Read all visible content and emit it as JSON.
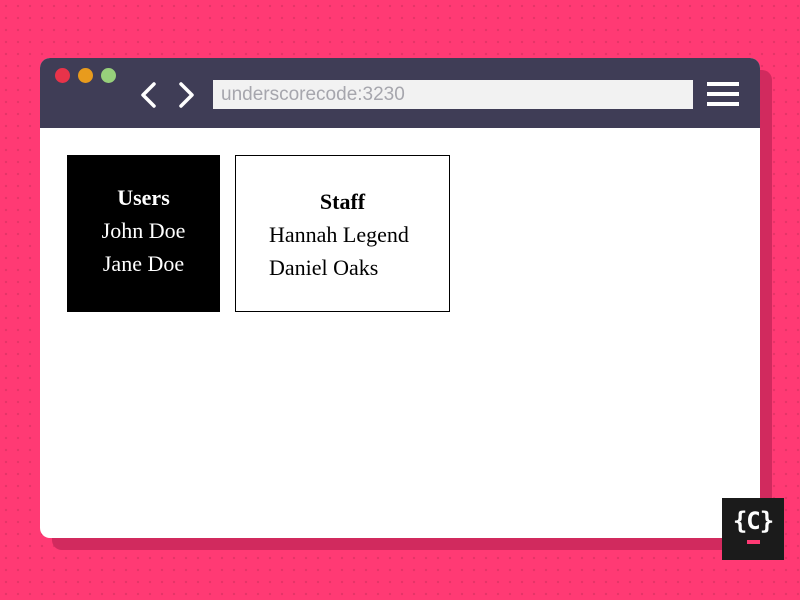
{
  "browser": {
    "address": "underscorecode:3230",
    "window_controls": [
      "close",
      "minimize",
      "maximize"
    ],
    "nav_icons": [
      "chevron-left-icon",
      "chevron-right-icon"
    ],
    "menu_icon": "hamburger-menu-icon"
  },
  "cards": {
    "users": {
      "title": "Users",
      "items": [
        "John Doe",
        "Jane Doe"
      ]
    },
    "staff": {
      "title": "Staff",
      "items": [
        "Hannah Legend",
        "Daniel Oaks"
      ]
    }
  },
  "logo": {
    "text": "{C}"
  },
  "colors": {
    "background": "#ff3a74",
    "titlebar": "#3f3d56",
    "close": "#e8334a",
    "minimize": "#e89b1d",
    "maximize": "#97d07b",
    "users_card": "#000000",
    "staff_card": "#ffffff"
  }
}
